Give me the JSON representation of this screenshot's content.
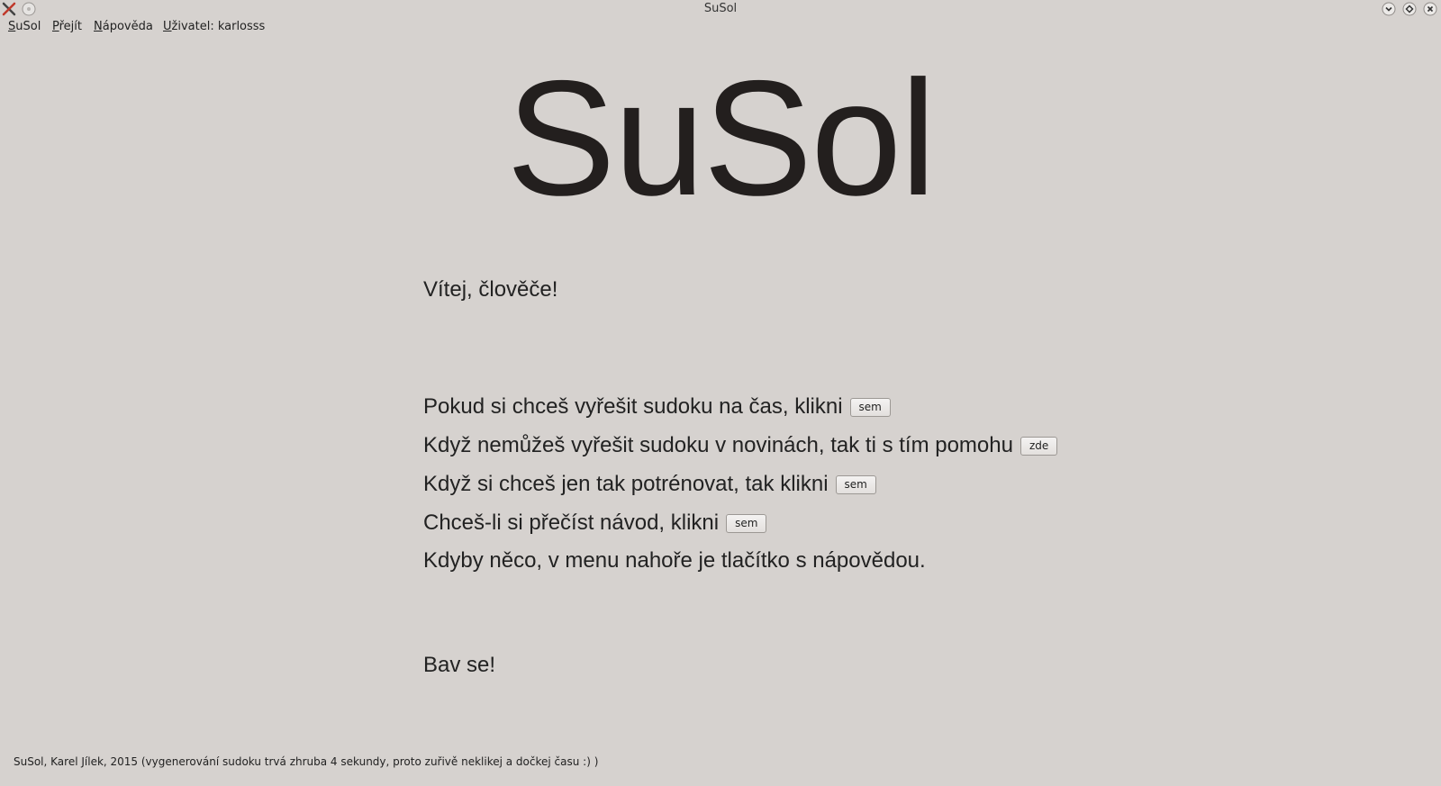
{
  "window": {
    "title": "SuSol"
  },
  "menu": {
    "items": [
      {
        "mnemonic": "S",
        "rest": "uSol"
      },
      {
        "mnemonic": "P",
        "rest": "řejít"
      },
      {
        "mnemonic": "N",
        "rest": "ápověda"
      },
      {
        "mnemonic": "U",
        "rest": "živatel: karlosss"
      }
    ]
  },
  "main": {
    "big_title": "SuSol",
    "greeting": "Vítej, člověče!",
    "lines": [
      {
        "text": "Pokud si chceš vyřešit sudoku na čas, klikni",
        "button": "sem"
      },
      {
        "text": "Když nemůžeš vyřešit sudoku v novinách, tak ti s tím pomohu",
        "button": "zde"
      },
      {
        "text": "Když si chceš jen tak potrénovat, tak klikni",
        "button": "sem"
      },
      {
        "text": "Chceš-li si přečíst návod, klikni",
        "button": "sem"
      },
      {
        "text": "Kdyby něco, v menu nahoře je tlačítko s nápovědou."
      }
    ],
    "closing": "Bav se!"
  },
  "footer": {
    "text": "SuSol, Karel Jílek, 2015 (vygenerování sudoku trvá zhruba 4 sekundy, proto zuřivě neklikej a dočkej času :) )"
  },
  "icons": {
    "app": "app-icon",
    "sticky": "sticky-icon",
    "minimize": "minimize-icon",
    "maximize": "maximize-icon",
    "close": "close-icon"
  }
}
